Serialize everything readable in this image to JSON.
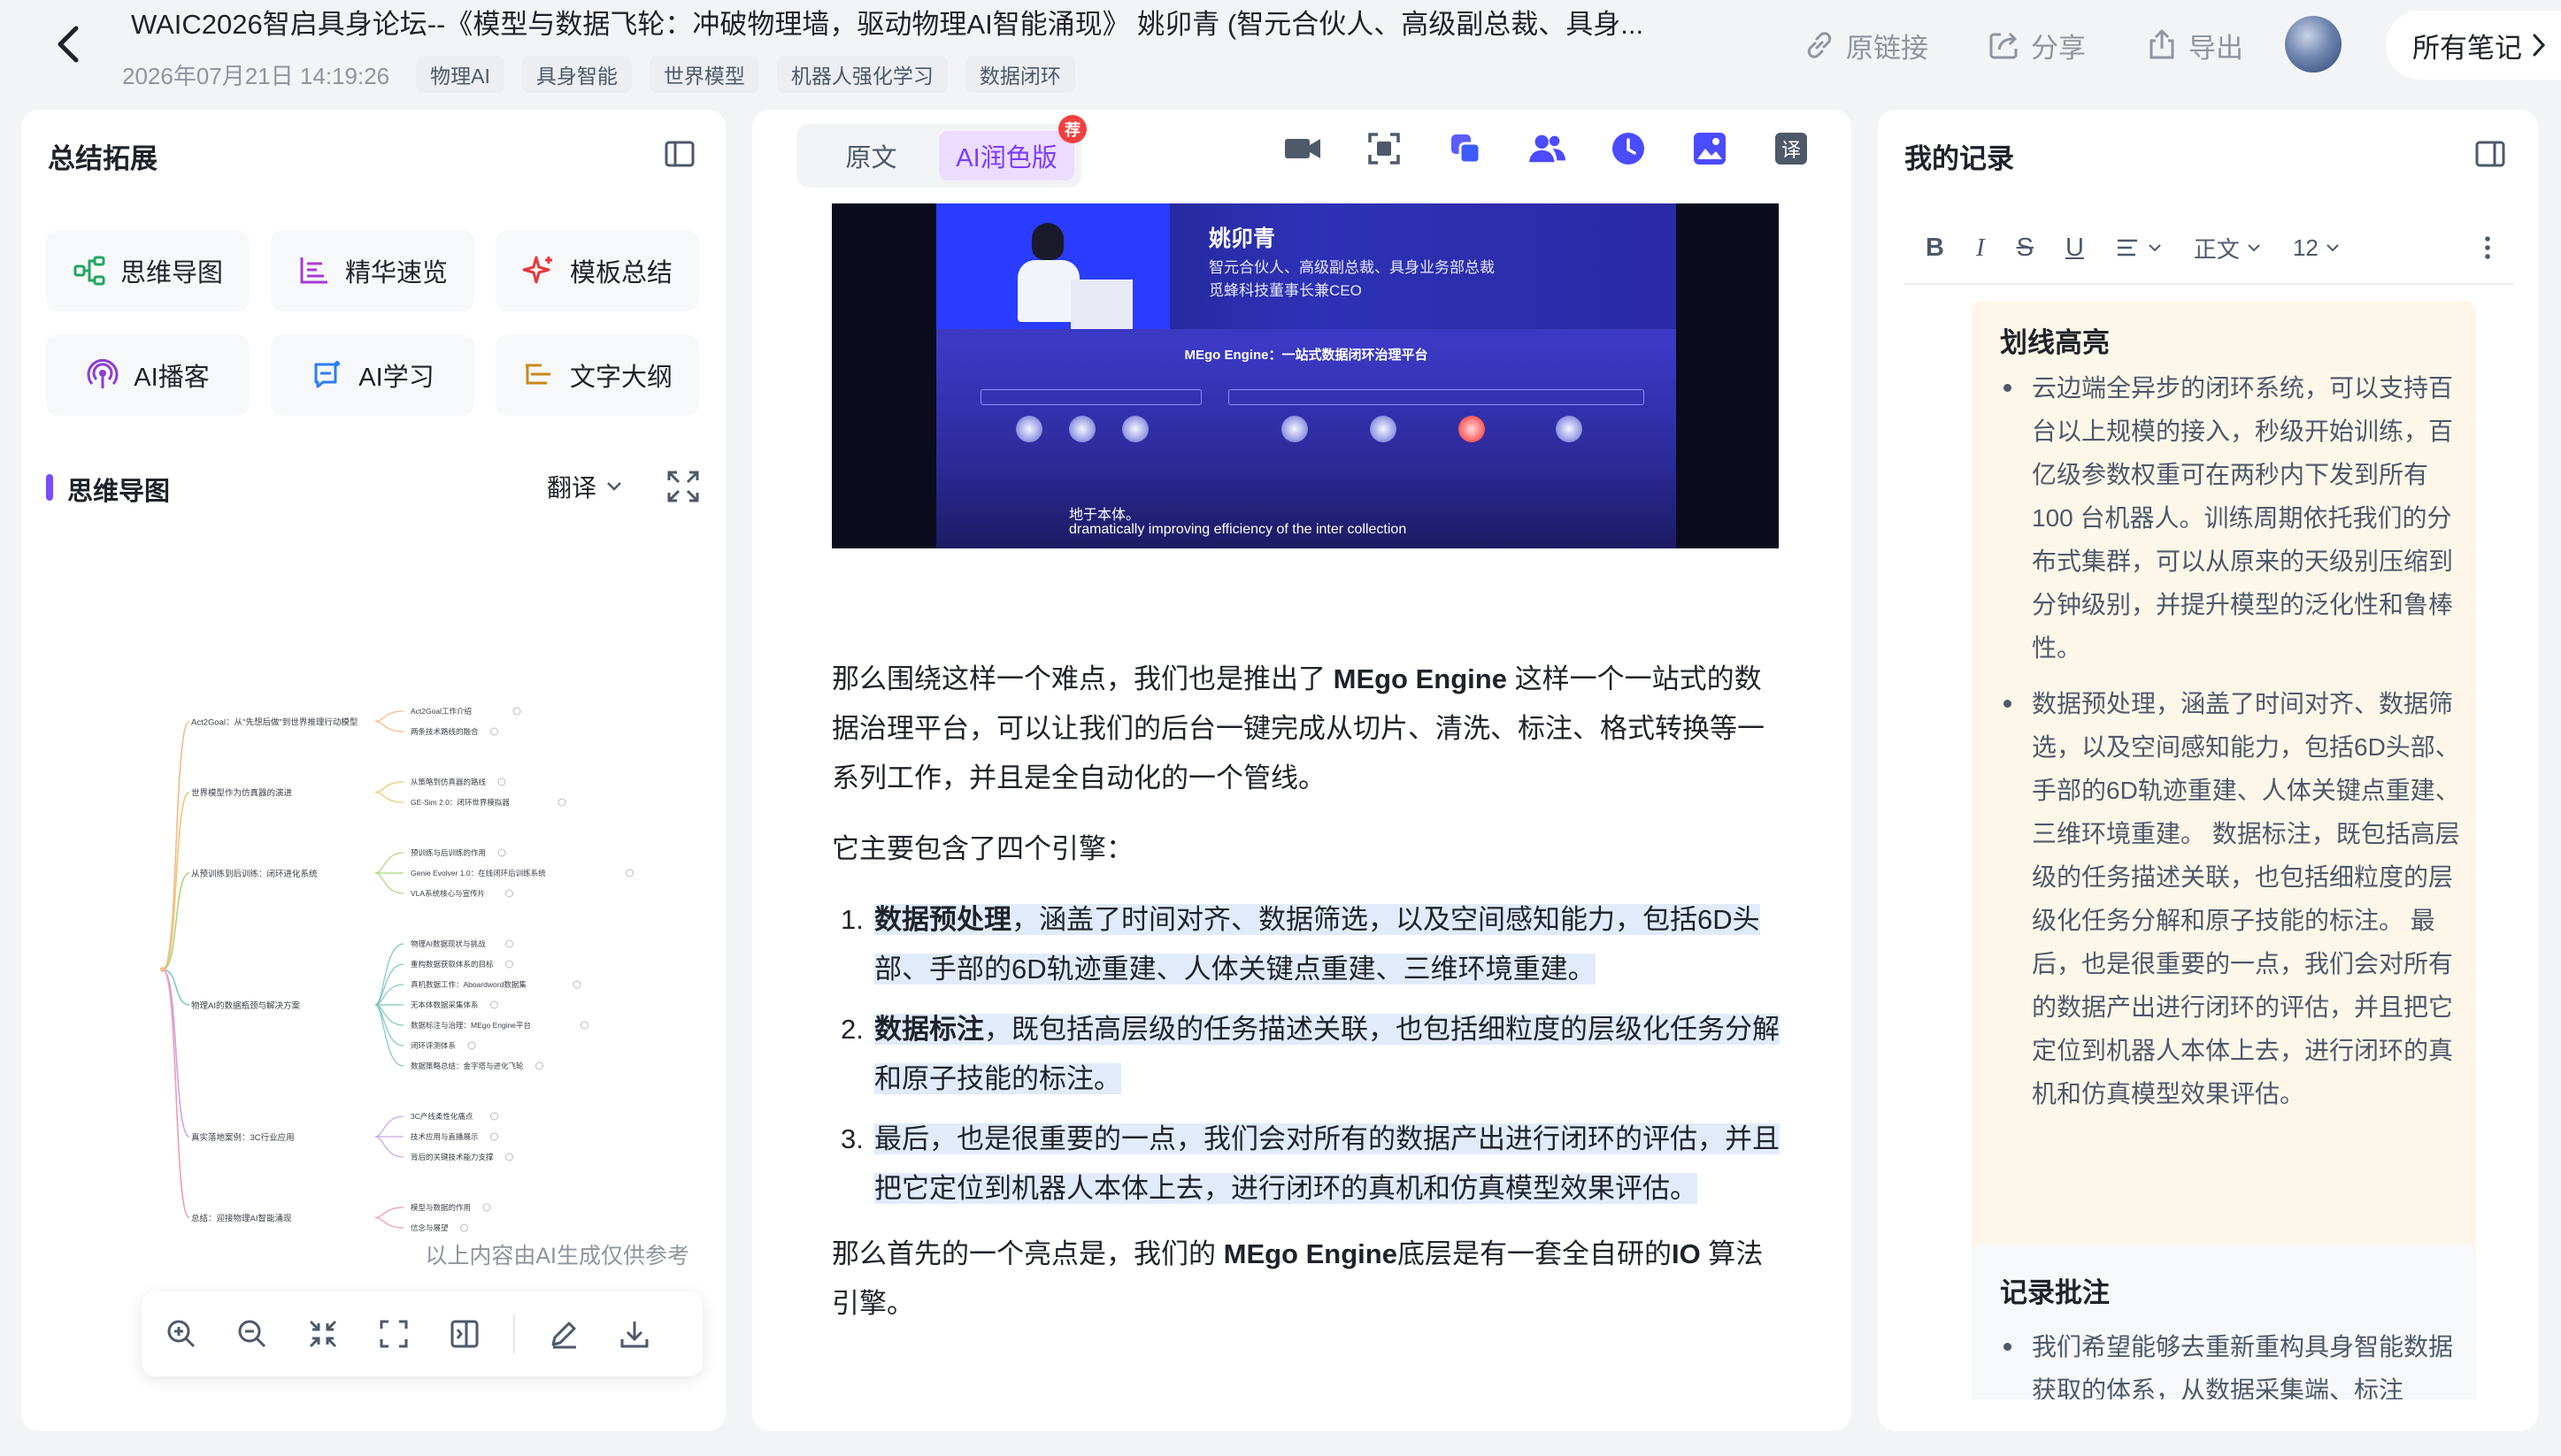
{
  "header": {
    "title": "WAIC2026智启具身论坛--《模型与数据飞轮：冲破物理墙，驱动物理AI智能涌现》 姚卯青 (智元合伙人、高级副总裁、具身...",
    "datetime": "2026年07月21日 14:19:26",
    "tags": [
      "物理AI",
      "具身智能",
      "世界模型",
      "机器人强化学习",
      "数据闭环"
    ],
    "actions": {
      "link": "原链接",
      "share": "分享",
      "export": "导出"
    },
    "all_notes": "所有笔记"
  },
  "left": {
    "title": "总结拓展",
    "features": [
      {
        "label": "思维导图",
        "icon": "mindmap-icon"
      },
      {
        "label": "精华速览",
        "icon": "highlights-icon"
      },
      {
        "label": "模板总结",
        "icon": "sparkle-icon"
      },
      {
        "label": "AI播客",
        "icon": "podcast-icon"
      },
      {
        "label": "AI学习",
        "icon": "ai-learn-icon"
      },
      {
        "label": "文字大纲",
        "icon": "outline-icon"
      }
    ],
    "mindmap_section": "思维导图",
    "translate": "翻译",
    "mindmap": {
      "branches": [
        {
          "label": "Act2Goal：从\"先想后做\"到世界推理行动模型",
          "leaves": [
            "Act2Goal工作介绍",
            "两条技术路线的融合"
          ]
        },
        {
          "label": "世界模型作为仿真器的演进",
          "leaves": [
            "从策略到仿真器的路线",
            "GE-Sim 2.0：闭环世界模拟器"
          ]
        },
        {
          "label": "从预训练到后训练：闭环进化系统",
          "leaves": [
            "预训练与后训练的作用",
            "Genie Evolver 1.0：在线闭环后训练系统",
            "VLA系统核心与宣传片"
          ]
        },
        {
          "label": "物理AI的数据瓶颈与解决方案",
          "leaves": [
            "物理AI数据现状与挑战",
            "重构数据获取体系的目标",
            "真机数据工作：Aboardword数据集",
            "无本体数据采集体系",
            "数据标注与治理：MEgo Engine平台",
            "闭环评测体系",
            "数据策略总结：金字塔与进化飞轮"
          ]
        },
        {
          "label": "真实落地案例：3C行业应用",
          "leaves": [
            "3C产线柔性化痛点",
            "技术应用与直播展示",
            "背后的关键技术能力支撑"
          ]
        },
        {
          "label": "总结：迎接物理AI智能涌现",
          "leaves": [
            "模型与数据的作用",
            "信念与展望"
          ]
        }
      ]
    },
    "ai_note": "以上内容由AI生成仅供参考"
  },
  "mid": {
    "tabs": {
      "original": "原文",
      "ai": "AI润色版"
    },
    "badge": "荐",
    "slide": {
      "name": "姚卯青",
      "desc1": "智元合伙人、高级副总裁、具身业务部总裁",
      "desc2": "觅蜂科技董事长兼CEO",
      "heading": "MEgo Engine：一站式数据闭环治理平台",
      "caption_cn": "地于本体。",
      "caption_en": "dramatically improving efficiency of the inter collection"
    },
    "p1_a": "那么围绕这样一个难点，我们也是推出了 ",
    "p1_b": "MEgo Engine",
    "p1_c": " 这样一个一站式的数据治理平台，可以让我们的后台一键完成从切片、清洗、标注、格式转换等一系列工作，并且是全自动化的一个管线。",
    "p2": "它主要包含了四个引擎：",
    "list": [
      {
        "num": "1.",
        "bold": "数据预处理",
        "text": "，涵盖了时间对齐、数据筛选，以及空间感知能力，包括6D头部、手部的6D轨迹重建、人体关键点重建、三维环境重建。"
      },
      {
        "num": "2.",
        "bold": "数据标注",
        "text": "，既包括高层级的任务描述关联，也包括细粒度的层级化任务分解和原子技能的标注。"
      },
      {
        "num": "3.",
        "bold": "",
        "text": "最后，也是很重要的一点，我们会对所有的数据产出进行闭环的评估，并且把它定位到机器人本体上去，进行闭环的真机和仿真模型效果评估。"
      }
    ],
    "p3_a": "那么首先的一个亮点是，我们的 ",
    "p3_b": "MEgo Engine",
    "p3_c": "底层是有一套全自研的",
    "p3_d": "IO",
    "p3_e": " 算法引擎。"
  },
  "right": {
    "title": "我的记录",
    "toolbar": {
      "bold": "B",
      "italic": "I",
      "strike": "S",
      "underline": "U",
      "style": "正文",
      "size": "12"
    },
    "highlight_title": "划线高亮",
    "highlights": [
      "云边端全异步的闭环系统，可以支持百台以上规模的接入，秒级开始训练，百亿级参数权重可在两秒内下发到所有 100 台机器人。训练周期依托我们的分布式集群，可以从原来的天级别压缩到分钟级别，并提升模型的泛化性和鲁棒性。",
      "数据预处理，涵盖了时间对齐、数据筛选，以及空间感知能力，包括6D头部、手部的6D轨迹重建、人体关键点重建、三维环境重建。 数据标注，既包括高层级的任务描述关联，也包括细粒度的层级化任务分解和原子技能的标注。 最后，也是很重要的一点，我们会对所有的数据产出进行闭环的评估，并且把它定位到机器人本体上去，进行闭环的真机和仿真模型效果评估。"
    ],
    "annotation_title": "记录批注",
    "annotations": [
      "我们希望能够去重新重构具身智能数据获取的体系，从数据采集端、标注"
    ]
  },
  "colors": {
    "accent": "#7b3cff",
    "brand_purple": "#7b4bff",
    "highlight_bg": "#e2ebfb",
    "note_bg": "#fdf7ea"
  }
}
